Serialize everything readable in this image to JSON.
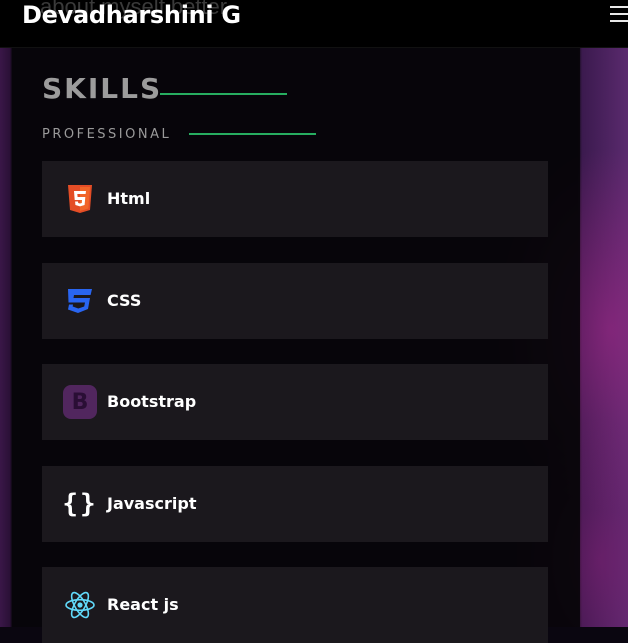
{
  "header": {
    "brand_name": "Devadharshini G",
    "behind_text": "about myself better",
    "menu_icon": "hamburger-menu-icon"
  },
  "skills": {
    "title": "SKILLS",
    "subtitle": "PROFESSIONAL",
    "accent_color": "#27ae60",
    "items": [
      {
        "label": "Html",
        "icon": "html5-icon",
        "color": "#e44d26"
      },
      {
        "label": "CSS",
        "icon": "css3-icon",
        "color": "#2965f1"
      },
      {
        "label": "Bootstrap",
        "icon": "bootstrap-icon",
        "color": "#51265e"
      },
      {
        "label": "Javascript",
        "icon": "javascript-braces-icon",
        "color": "#ffffff"
      },
      {
        "label": "React js",
        "icon": "react-icon",
        "color": "#61dafb"
      }
    ]
  }
}
